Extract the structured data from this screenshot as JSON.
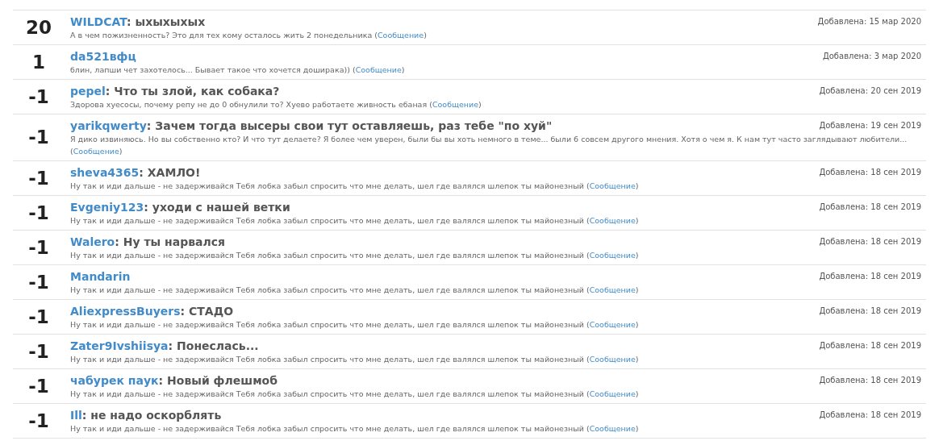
{
  "entries": [
    {
      "score": "20",
      "author": "WILDCAT",
      "subject": ": ыхыхыхых",
      "date": "Добавлена: 15 мар 2020",
      "message": "А в чем пожизненность? Это для тех кому осталось жить 2 понедельника",
      "link_prefix": "(",
      "link": "Сообщение",
      "link_suffix": ")"
    },
    {
      "score": "1",
      "author": "da521вфц",
      "date": "Добавлена: 3 мар 2020",
      "message": "блин, лапши чет захотелось... Бывает такое что хочется доширака))",
      "link_prefix": "(",
      "link": "Сообщение",
      "link_suffix": ")"
    },
    {
      "score": "-1",
      "author": "pepel",
      "subject": ": Что ты злой, как собака?",
      "date": "Добавлена: 20 сен 2019",
      "message": "Здорова хуесосы, почему репу не до 0 обнулили то? Хуево работаете живность ебаная",
      "link_prefix": "(",
      "link": "Сообщение",
      "link_suffix": ")"
    },
    {
      "score": "-1",
      "author": "yarikqwerty",
      "subject": ": Зачем тогда высеры свои тут оставляешь, раз тебе \"по хуй\"",
      "date": "Добавлена: 19 сен 2019",
      "message": "Я дико извиняюсь. Но вы собственно кто? И что тут делаете? Я более чем уверен, были бы вы хоть немного в теме... были 6 совсем другого мнения. Хотя о чем я. К нам тут часто заглядывают любители...",
      "link_prefix": "(",
      "link": "Сообщение",
      "link_suffix": ")"
    },
    {
      "score": "-1",
      "author": "sheva4365",
      "subject": ": ХАМЛО!",
      "date": "Добавлена: 18 сен 2019",
      "message": "Ну так и иди дальше - не задерживайся Тебя лобка забыл спросить что мне делать, шел где валялся шлепок ты майонезный",
      "link_prefix": "(",
      "link": "Сообщение",
      "link_suffix": ")"
    },
    {
      "score": "-1",
      "author": "Evgeniy123",
      "subject": ": уходи с нашей ветки",
      "date": "Добавлена: 18 сен 2019",
      "message": "Ну так и иди дальше - не задерживайся Тебя лобка забыл спросить что мне делать, шел где валялся шлепок ты майонезный",
      "link_prefix": "(",
      "link": "Сообщение",
      "link_suffix": ")"
    },
    {
      "score": "-1",
      "author": "Walero",
      "subject": ": Ну ты нарвался",
      "date": "Добавлена: 18 сен 2019",
      "message": "Ну так и иди дальше - не задерживайся Тебя лобка забыл спросить что мне делать, шел где валялся шлепок ты майонезный",
      "link_prefix": "(",
      "link": "Сообщение",
      "link_suffix": ")"
    },
    {
      "score": "-1",
      "author": "Mandarin",
      "date": "Добавлена: 18 сен 2019",
      "message": "Ну так и иди дальше - не задерживайся Тебя лобка забыл спросить что мне делать, шел где валялся шлепок ты майонезный",
      "link_prefix": "(",
      "link": "Сообщение",
      "link_suffix": ")"
    },
    {
      "score": "-1",
      "author": "AliexpressBuyers",
      "subject": ": СТАДО",
      "date": "Добавлена: 18 сен 2019",
      "message": "Ну так и иди дальше - не задерживайся Тебя лобка забыл спросить что мне делать, шел где валялся шлепок ты майонезный",
      "link_prefix": "(",
      "link": "Сообщение",
      "link_suffix": ")"
    },
    {
      "score": "-1",
      "author": "Zater9Ivshiisya",
      "subject": ": Понеслась...",
      "date": "Добавлена: 18 сен 2019",
      "message": "Ну так и иди дальше - не задерживайся Тебя лобка забыл спросить что мне делать, шел где валялся шлепок ты майонезный",
      "link_prefix": "(",
      "link": "Сообщение",
      "link_suffix": ")"
    },
    {
      "score": "-1",
      "author": "чабурек паук",
      "subject": ": Новый флешмоб",
      "date": "Добавлена: 18 сен 2019",
      "message": "Ну так и иди дальше - не задерживайся Тебя лобка забыл спросить что мне делать, шел где валялся шлепок ты майонезный",
      "link_prefix": "(",
      "link": "Сообщение",
      "link_suffix": ")"
    },
    {
      "score": "-1",
      "author": "Ill",
      "subject": ": не надо оскорблять",
      "date": "Добавлена: 18 сен 2019",
      "message": "Ну так и иди дальше - не задерживайся Тебя лобка забыл спросить что мне делать, шел где валялся шлепок ты майонезный",
      "link_prefix": "(",
      "link": "Сообщение",
      "link_suffix": ")"
    }
  ]
}
